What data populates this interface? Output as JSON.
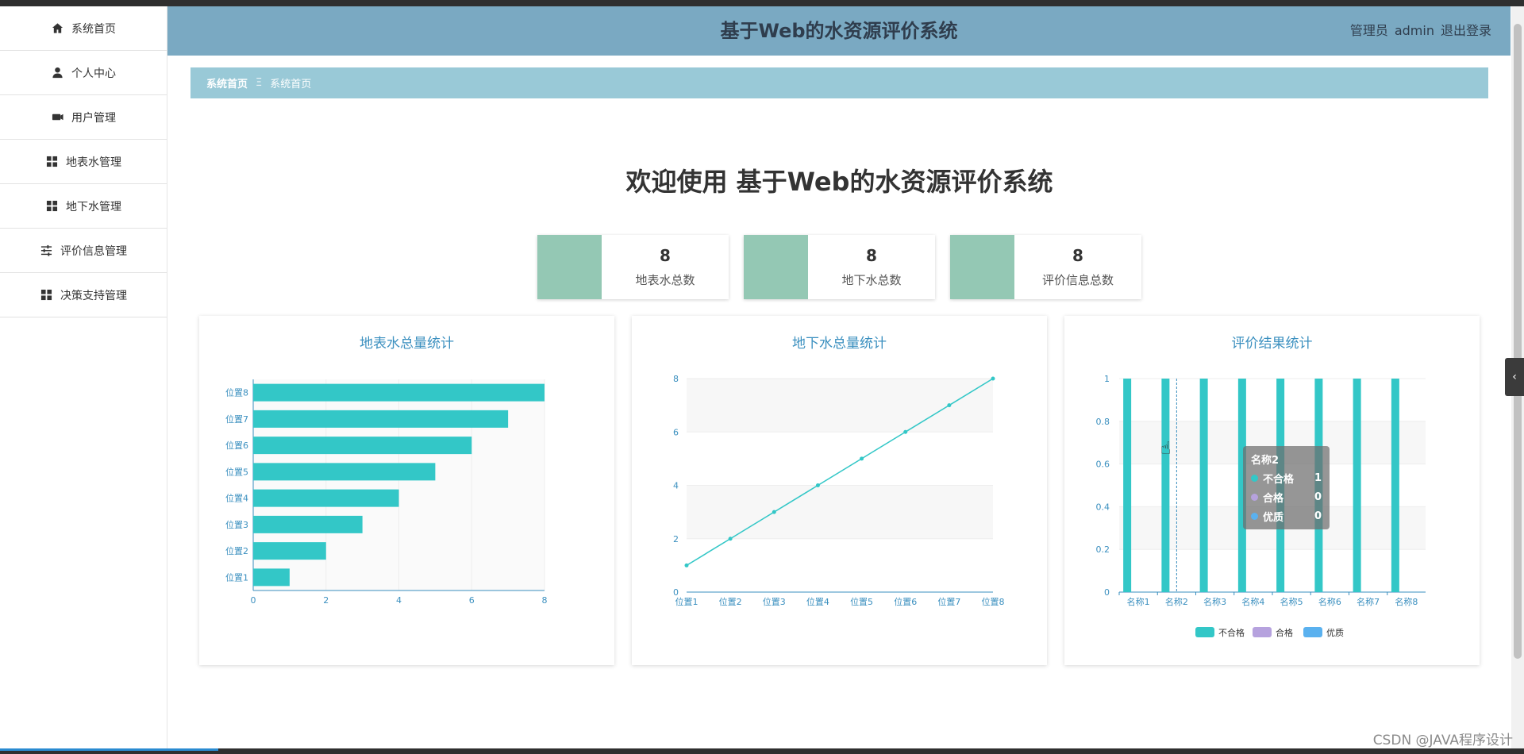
{
  "header": {
    "title": "基于Web的水资源评价系统",
    "user_role": "管理员",
    "username": "admin",
    "logout_label": "退出登录"
  },
  "sidebar": {
    "items": [
      {
        "label": "系统首页",
        "icon": "home-icon"
      },
      {
        "label": "个人中心",
        "icon": "user-icon"
      },
      {
        "label": "用户管理",
        "icon": "users-icon"
      },
      {
        "label": "地表水管理",
        "icon": "grid-icon"
      },
      {
        "label": "地下水管理",
        "icon": "grid-icon"
      },
      {
        "label": "评价信息管理",
        "icon": "sliders-icon"
      },
      {
        "label": "决策支持管理",
        "icon": "grid-icon"
      }
    ]
  },
  "breadcrumb": {
    "root": "系统首页",
    "separator": "Ξ",
    "current": "系统首页"
  },
  "welcome": "欢迎使用 基于Web的水资源评价系统",
  "stats": [
    {
      "value": "8",
      "label": "地表水总数"
    },
    {
      "value": "8",
      "label": "地下水总数"
    },
    {
      "value": "8",
      "label": "评价信息总数"
    }
  ],
  "colors": {
    "teal": "#33c7c7",
    "purple": "#b6a2de",
    "blue": "#5ab1ef",
    "title_blue": "#3a8fbf",
    "axis": "#3a8fbf"
  },
  "chart_data": [
    {
      "type": "bar",
      "orientation": "horizontal",
      "title": "地表水总量统计",
      "categories": [
        "位置1",
        "位置2",
        "位置3",
        "位置4",
        "位置5",
        "位置6",
        "位置7",
        "位置8"
      ],
      "values": [
        1,
        2,
        3,
        4,
        5,
        6,
        7,
        8
      ],
      "xlim": [
        0,
        8
      ],
      "xticks": [
        0,
        2,
        4,
        6,
        8
      ],
      "grid": true
    },
    {
      "type": "line",
      "title": "地下水总量统计",
      "categories": [
        "位置1",
        "位置2",
        "位置3",
        "位置4",
        "位置5",
        "位置6",
        "位置7",
        "位置8"
      ],
      "values": [
        1,
        2,
        3,
        4,
        5,
        6,
        7,
        8
      ],
      "ylim": [
        0,
        8
      ],
      "yticks": [
        0,
        2,
        4,
        6,
        8
      ],
      "grid": true
    },
    {
      "type": "bar",
      "title": "评价结果统计",
      "categories": [
        "名称1",
        "名称2",
        "名称3",
        "名称4",
        "名称5",
        "名称6",
        "名称7",
        "名称8"
      ],
      "series": [
        {
          "name": "不合格",
          "values": [
            1,
            1,
            1,
            1,
            1,
            1,
            1,
            1
          ]
        },
        {
          "name": "合格",
          "values": [
            0,
            0,
            0,
            0,
            0,
            0,
            0,
            0
          ]
        },
        {
          "name": "优质",
          "values": [
            0,
            0,
            0,
            0,
            0,
            0,
            0,
            0
          ]
        }
      ],
      "ylim": [
        0,
        1
      ],
      "yticks": [
        "0",
        "0.2",
        "0.4",
        "0.6",
        "0.8",
        "1"
      ],
      "legend": "bottom",
      "grid": true,
      "tooltip": {
        "title": "名称2",
        "rows": [
          {
            "name": "不合格",
            "value": "1"
          },
          {
            "name": "合格",
            "value": "0"
          },
          {
            "name": "优质",
            "value": "0"
          }
        ]
      }
    }
  ],
  "watermark": "CSDN @JAVA程序设计"
}
